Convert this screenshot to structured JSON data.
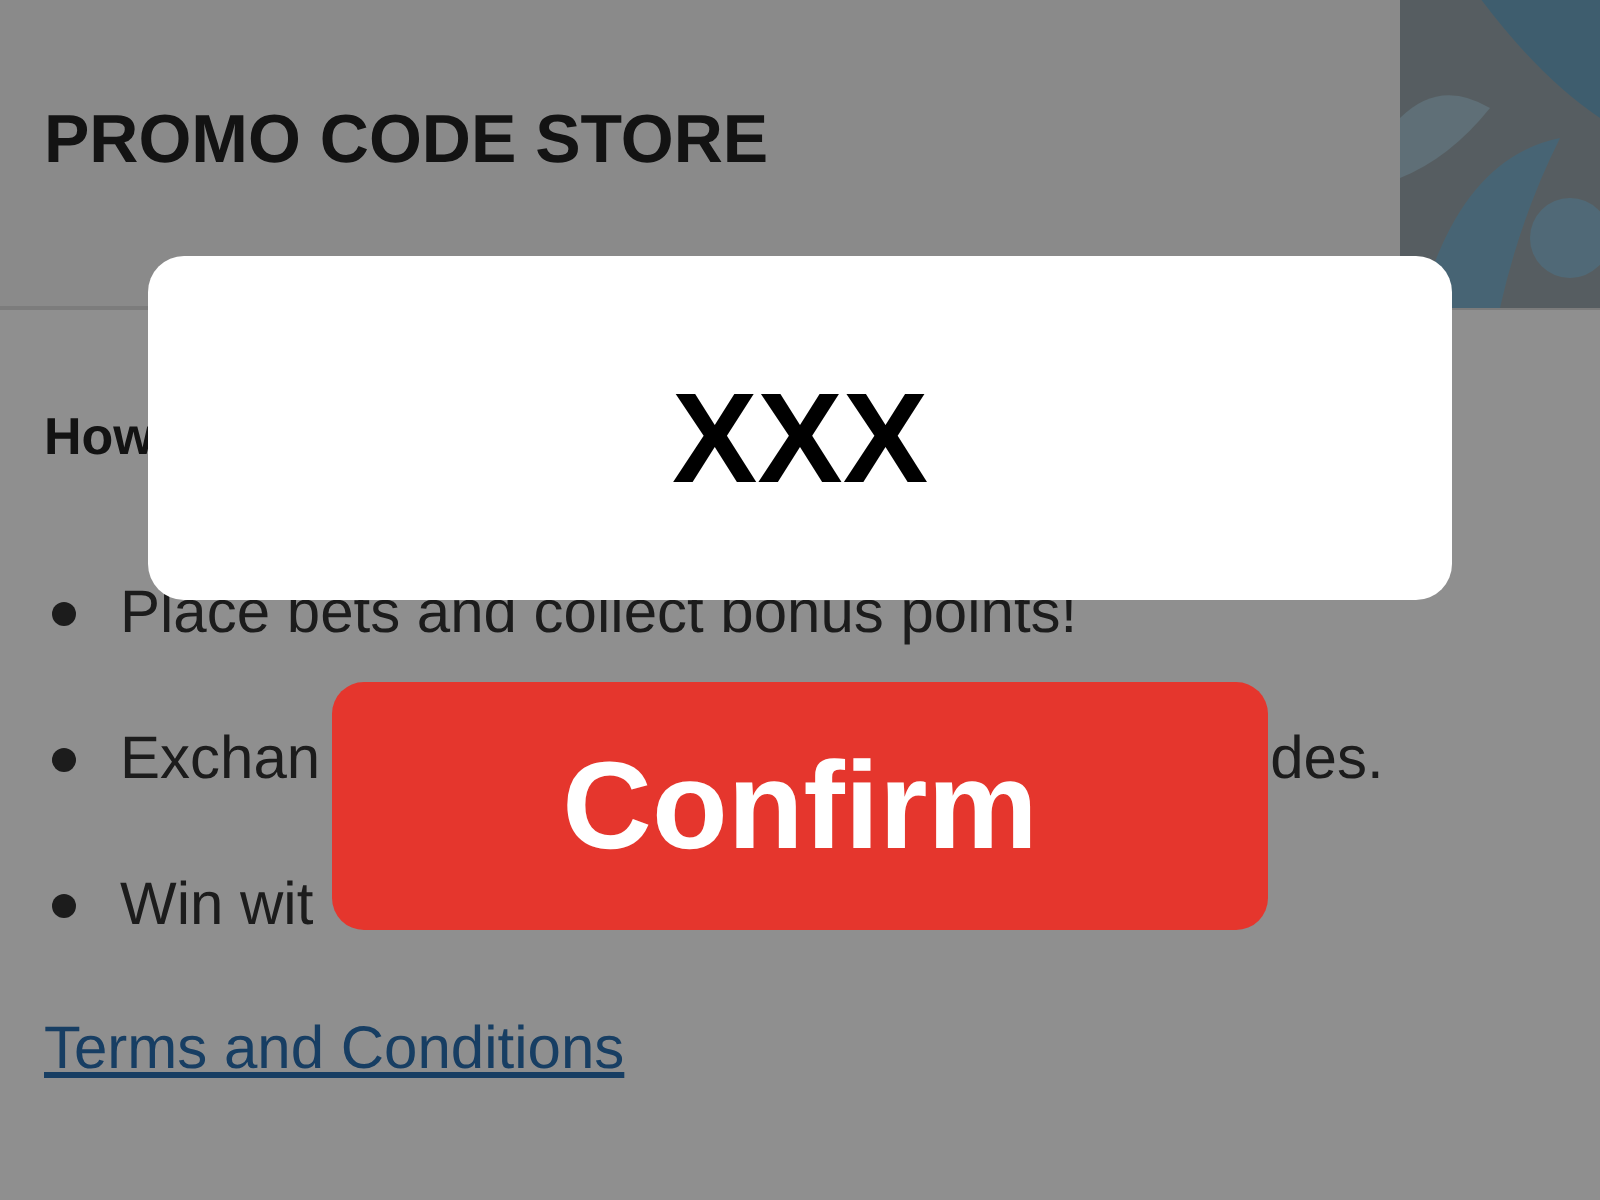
{
  "header": {
    "title": "PROMO CODE STORE"
  },
  "section": {
    "heading": "How"
  },
  "bullets": [
    {
      "parts": [
        "Place bets and collect bonus points!"
      ]
    },
    {
      "parts": [
        "Exchan",
        "des."
      ]
    },
    {
      "parts": [
        "Win wit"
      ]
    }
  ],
  "link": "Terms and Conditions",
  "dialog": {
    "code": "XXX",
    "button": "Confirm"
  }
}
